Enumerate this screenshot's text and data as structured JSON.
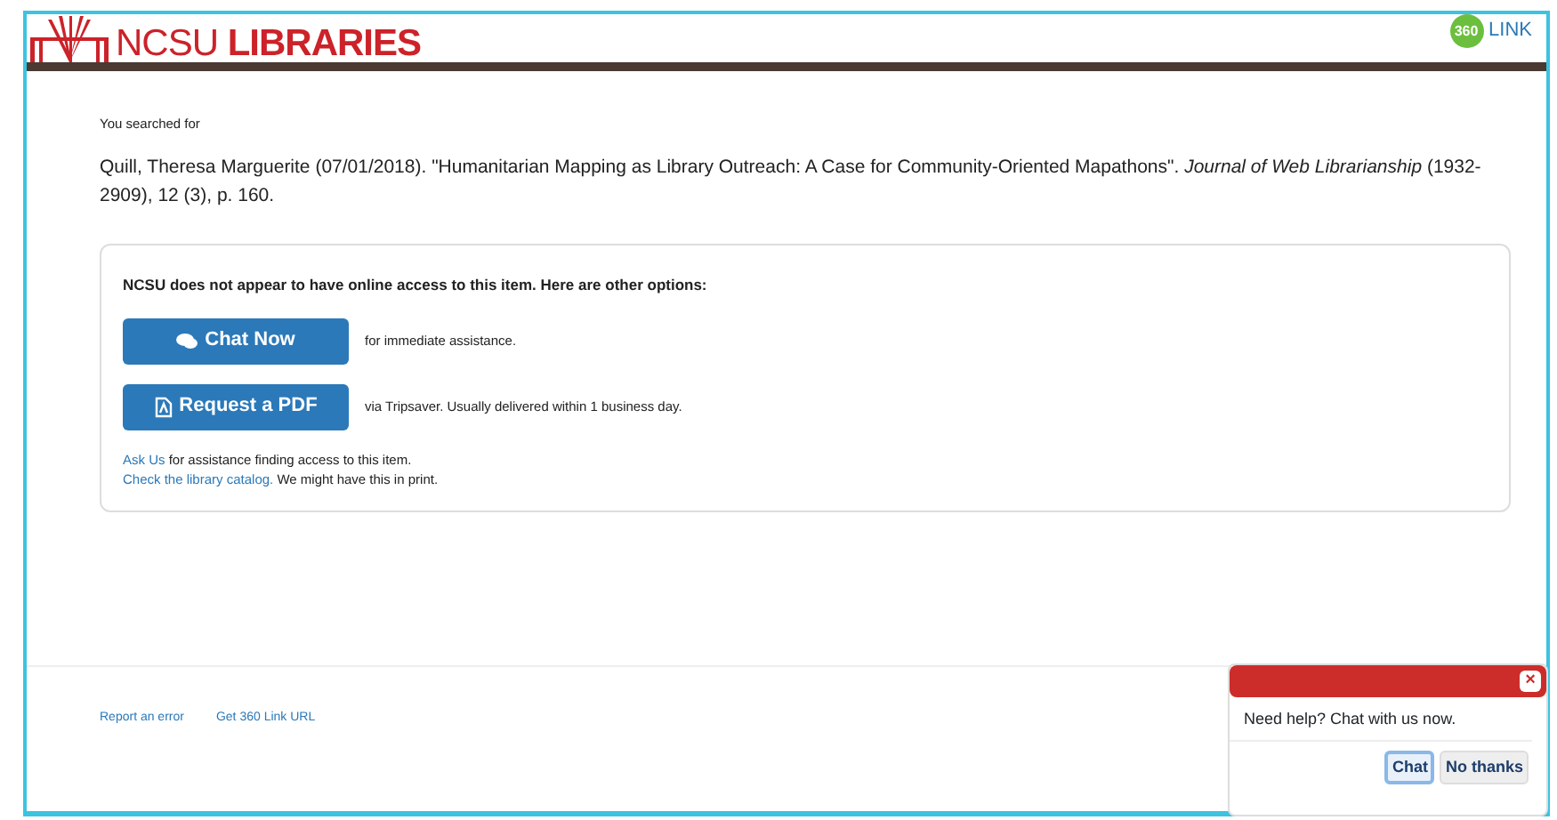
{
  "header": {
    "logo_text": "NCSU",
    "logo_bold": "LIBRARIES",
    "badge": "360",
    "link_text": "LINK"
  },
  "search": {
    "label": "You searched for",
    "citation": "Quill, Theresa Marguerite (07/01/2018). \"Humanitarian Mapping as Library Outreach: A Case for Community-Oriented Mapathons\". *Journal of Web Librarianship* (1932-2909), 12 (3), p. 160."
  },
  "options": {
    "heading": "NCSU does not appear to have online access to this item. Here are other options:",
    "actions": [
      {
        "kind": "chat",
        "label": "Chat Now",
        "note": "for immediate assistance."
      },
      {
        "kind": "pdf",
        "label": "Request a PDF",
        "note": "via Tripsaver. Usually delivered within 1 business day."
      }
    ],
    "links": [
      {
        "link": "Ask Us",
        "text": "for assistance finding access to this item."
      },
      {
        "link": "Check the library catalog.",
        "text": "We might have this in print."
      }
    ]
  },
  "footer": {
    "links": [
      "Report an error",
      "Get 360 Link URL"
    ]
  },
  "chat_popup": {
    "close": "×",
    "message": "Need help? Chat with us now.",
    "buttons": [
      {
        "label": "Chat",
        "selected": true
      },
      {
        "label": "No thanks",
        "selected": false
      }
    ]
  }
}
